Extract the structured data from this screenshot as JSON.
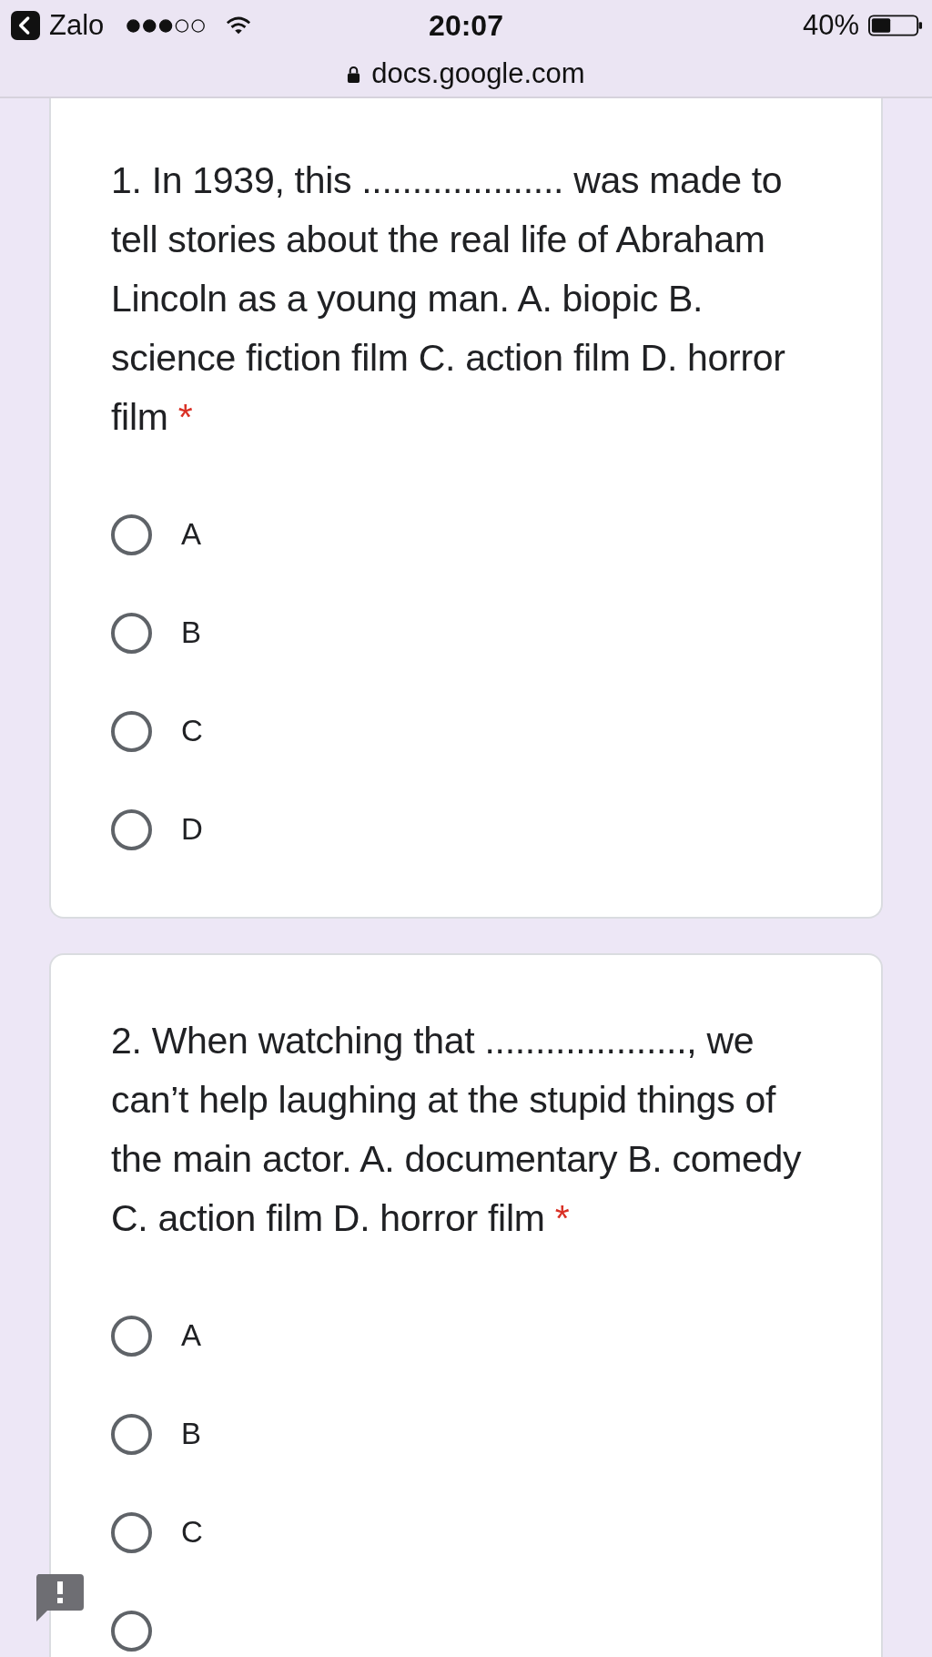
{
  "status_bar": {
    "back_app": "Zalo",
    "time": "20:07",
    "battery": "40%"
  },
  "address_bar": {
    "url": "docs.google.com"
  },
  "questions": [
    {
      "text": "1. In 1939, this .................... was made to tell stories about the real life of Abraham Lincoln as a young man. A. biopic B. science fiction film C. action film D. horror film",
      "required_mark": "*",
      "options": [
        {
          "label": "A",
          "selected": false
        },
        {
          "label": "B",
          "selected": false
        },
        {
          "label": "C",
          "selected": false
        },
        {
          "label": "D",
          "selected": false
        }
      ]
    },
    {
      "text": "2. When watching that ...................., we can’t help laughing at the stupid things of the main actor. A. documentary B. comedy C. action film D. horror film",
      "required_mark": "*",
      "options": [
        {
          "label": "A",
          "selected": false
        },
        {
          "label": "B",
          "selected": false
        },
        {
          "label": "C",
          "selected": false
        }
      ],
      "more_options_cut": true
    }
  ]
}
